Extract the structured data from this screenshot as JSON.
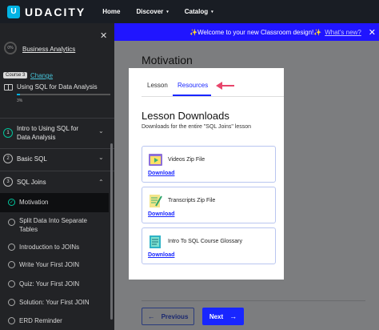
{
  "topnav": {
    "logo_text": "UDACITY",
    "links": [
      {
        "label": "Home"
      },
      {
        "label": "Discover",
        "caret": "▾"
      },
      {
        "label": "Catalog",
        "caret": "▾"
      }
    ]
  },
  "banner": {
    "text": "✨Welcome to your new Classroom design!✨",
    "link": "What's new?",
    "close": "✕"
  },
  "sidebar": {
    "close": "✕",
    "course_pct": "0%",
    "course_title": "Business Analytics",
    "course_badge": "Course 3",
    "change_link": "Change",
    "lesson_name": "Using SQL for Data Analysis",
    "progress": 0.03,
    "progress_pct": "3%",
    "sections": [
      {
        "num": "1",
        "label": "Intro to Using SQL for Data Analysis",
        "chevron": "⌄"
      },
      {
        "num": "2",
        "label": "Basic SQL",
        "chevron": "⌄"
      },
      {
        "num": "3",
        "label": "SQL Joins",
        "chevron": "⌃"
      }
    ],
    "concepts": [
      {
        "label": "Motivation",
        "state": "active"
      },
      {
        "label": "Split Data Into Separate Tables",
        "state": "todo"
      },
      {
        "label": "Introduction to JOINs",
        "state": "todo"
      },
      {
        "label": "Write Your First JOIN",
        "state": "todo"
      },
      {
        "label": "Quiz: Your First JOIN",
        "state": "todo"
      },
      {
        "label": "Solution: Your First JOIN",
        "state": "todo"
      },
      {
        "label": "ERD Reminder",
        "state": "todo"
      }
    ]
  },
  "main": {
    "title": "Motivation",
    "tabs": [
      {
        "label": "Lesson"
      },
      {
        "label": "Resources"
      }
    ],
    "downloads_title": "Lesson Downloads",
    "downloads_sub": "Downloads for the entire \"SQL Joins\" lesson",
    "downloads": [
      {
        "name": "Videos Zip File",
        "link": "Download",
        "icon": "video-file-icon"
      },
      {
        "name": "Transcripts Zip File",
        "link": "Download",
        "icon": "transcript-file-icon"
      },
      {
        "name": "Intro To SQL Course Glossary",
        "link": "Download",
        "icon": "glossary-file-icon"
      }
    ],
    "prev_button": "Previous",
    "next_button": "Next"
  },
  "colors": {
    "accent": "#1826ff",
    "brand": "#02b3e4",
    "annotation_arrow": "#e8456b"
  }
}
